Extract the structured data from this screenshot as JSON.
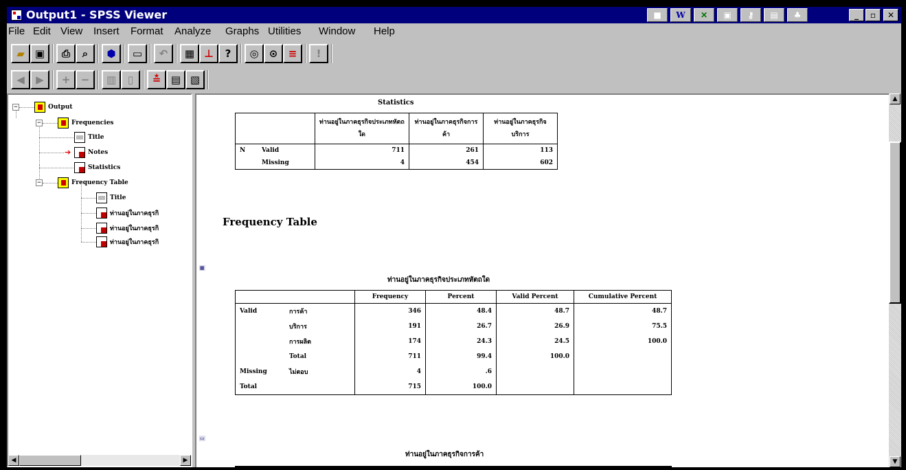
{
  "window": {
    "title": "Output1 - SPSS Viewer"
  },
  "menu": [
    "File",
    "Edit",
    "View",
    "Insert",
    "Format",
    "Analyze",
    "Graphs",
    "Utilities",
    "Window",
    "Help"
  ],
  "outline": {
    "output": "Output",
    "frequencies": "Frequencies",
    "title": "Title",
    "notes": "Notes",
    "statistics": "Statistics",
    "frequency_table": "Frequency Table",
    "title2": "Title",
    "var1": "ท่านอยู่ในภาคธุรกิ",
    "var2": "ท่านอยู่ในภาคธุรกิ",
    "var3": "ท่านอยู่ในภาคธุรกิ"
  },
  "statistics": {
    "caption": "Statistics",
    "headers": [
      "ท่านอยู่ในภาคธุรกิจประเภทหัตถใด",
      "ท่านอยู่ในภาคธุรกิจการค้า",
      "ท่านอยู่ในภาคธุรกิจบริการ"
    ],
    "n_label": "N",
    "valid_label": "Valid",
    "missing_label": "Missing",
    "valid": [
      "711",
      "261",
      "113"
    ],
    "missing": [
      "4",
      "454",
      "602"
    ]
  },
  "frequency_heading": "Frequency Table",
  "freq_table": {
    "caption": "ท่านอยู่ในภาคธุรกิจประเภทหัตถใด",
    "headers": [
      "Frequency",
      "Percent",
      "Valid Percent",
      "Cumulative Percent"
    ],
    "valid_label": "Valid",
    "missing_label": "Missing",
    "total_label": "Total",
    "rows": [
      {
        "cat": "การค้า",
        "freq": "346",
        "pct": "48.4",
        "vpct": "48.7",
        "cpct": "48.7"
      },
      {
        "cat": "บริการ",
        "freq": "191",
        "pct": "26.7",
        "vpct": "26.9",
        "cpct": "75.5"
      },
      {
        "cat": "การผลิต",
        "freq": "174",
        "pct": "24.3",
        "vpct": "24.5",
        "cpct": "100.0"
      },
      {
        "cat": "Total",
        "freq": "711",
        "pct": "99.4",
        "vpct": "100.0",
        "cpct": ""
      }
    ],
    "missing_row": {
      "cat": "ไม่ตอบ",
      "freq": "4",
      "pct": ".6"
    },
    "total_row": {
      "freq": "715",
      "pct": "100.0"
    }
  },
  "next_caption": "ท่านอยู่ในภาคธุรกิจการค้า",
  "colors": {
    "titlebar": "#00007c",
    "chrome": "#c0c0c0",
    "book": "#ffff00"
  }
}
